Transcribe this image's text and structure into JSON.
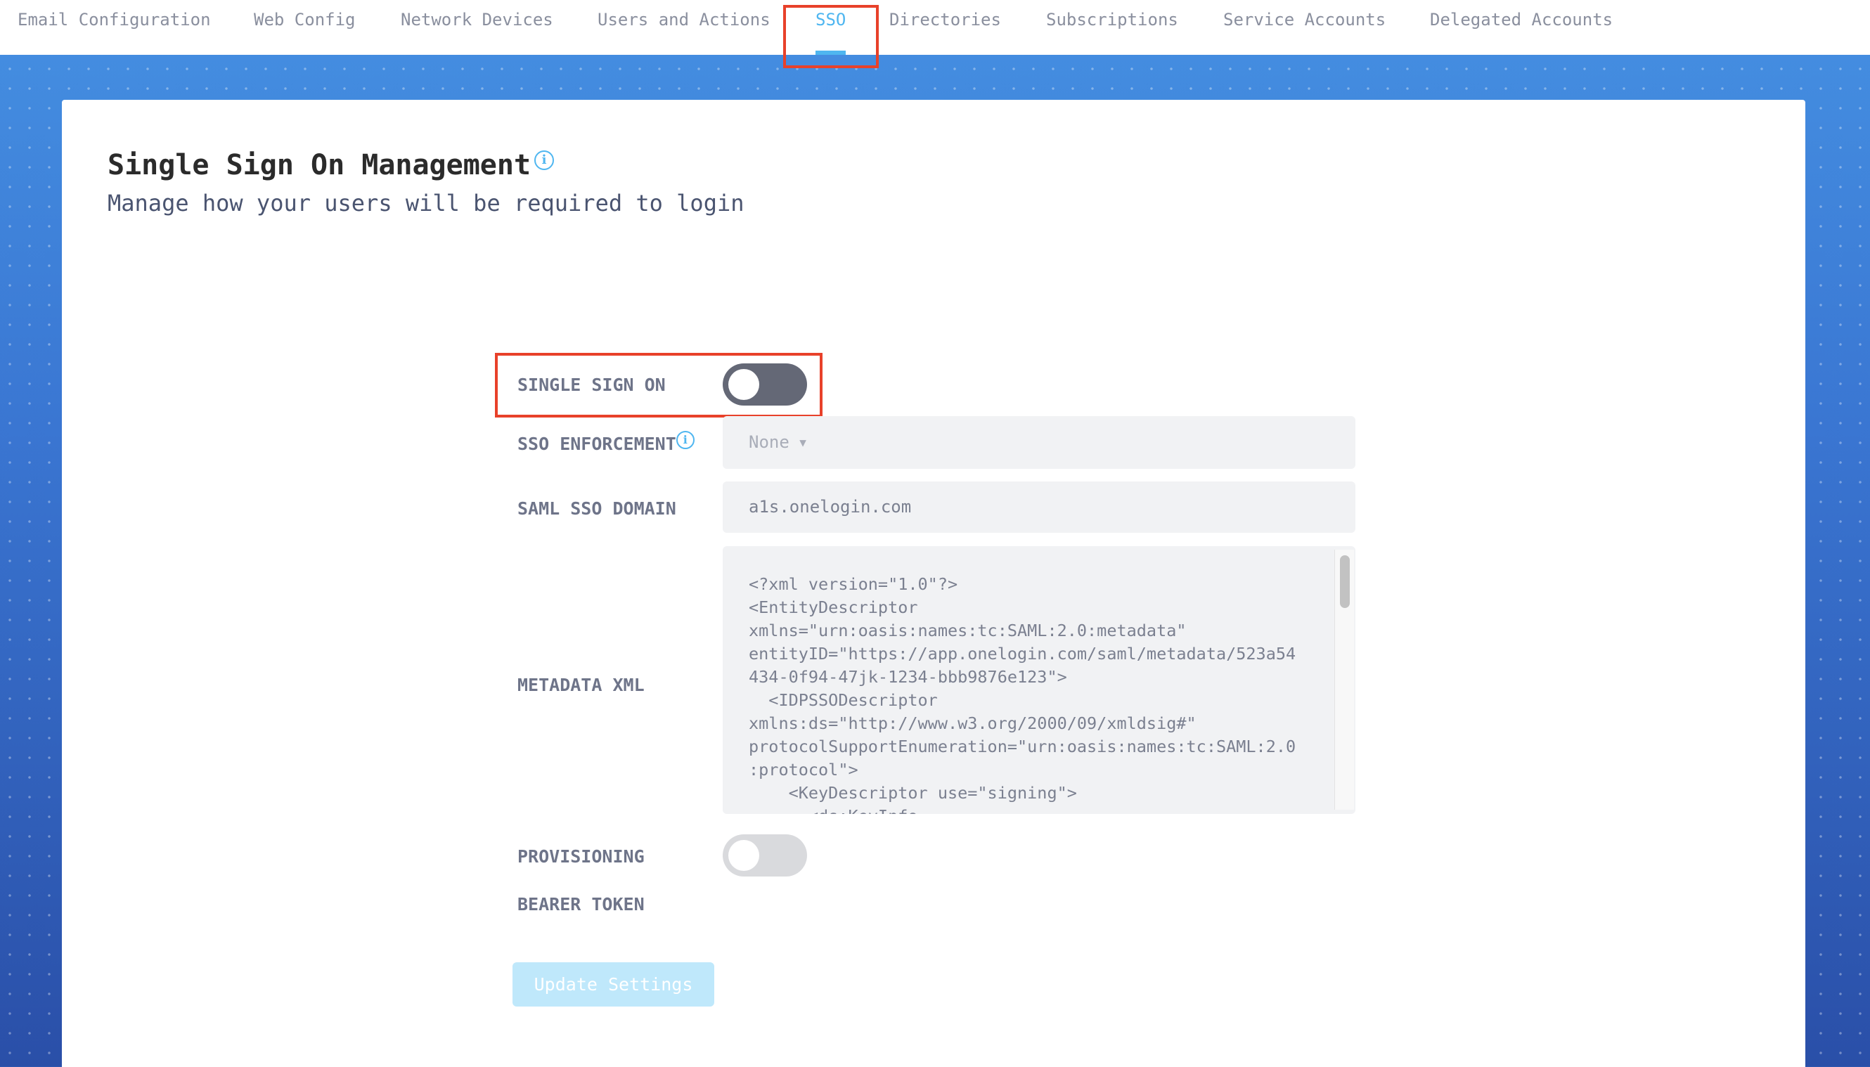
{
  "tabs": [
    {
      "label": "Email Configuration"
    },
    {
      "label": "Web Config"
    },
    {
      "label": "Network Devices"
    },
    {
      "label": "Users and Actions"
    },
    {
      "label": "SSO",
      "active": true
    },
    {
      "label": "Directories"
    },
    {
      "label": "Subscriptions"
    },
    {
      "label": "Service Accounts"
    },
    {
      "label": "Delegated Accounts"
    }
  ],
  "colors": {
    "accent": "#4fb6f0",
    "highlight_box": "#e8412a",
    "toggle_dark": "#646876",
    "toggle_off": "#d9dadd",
    "button": "#bfe8fb"
  },
  "page": {
    "title": "Single Sign On Management",
    "info_icon": "i",
    "subtitle": "Manage how your users will be required to login"
  },
  "form": {
    "sso_label": "SINGLE SIGN ON",
    "sso_enabled": false,
    "enforcement_label": "SSO ENFORCEMENT",
    "enforcement_value": "None",
    "enforcement_arrow": "▼",
    "domain_label": "SAML SSO DOMAIN",
    "domain_value": "a1s.onelogin.com",
    "metadata_label": "METADATA XML",
    "metadata_xml": "<?xml version=\"1.0\"?>\n<EntityDescriptor\nxmlns=\"urn:oasis:names:tc:SAML:2.0:metadata\"\nentityID=\"https://app.onelogin.com/saml/metadata/523a54\n434-0f94-47jk-1234-bbb9876e123\">\n  <IDPSSODescriptor\nxmlns:ds=\"http://www.w3.org/2000/09/xmldsig#\"\nprotocolSupportEnumeration=\"urn:oasis:names:tc:SAML:2.0\n:protocol\">\n    <KeyDescriptor use=\"signing\">\n      <ds:KeyInfo",
    "provisioning_label": "PROVISIONING",
    "provisioning_enabled": false,
    "bearer_label": "BEARER TOKEN",
    "update_button": "Update Settings"
  }
}
